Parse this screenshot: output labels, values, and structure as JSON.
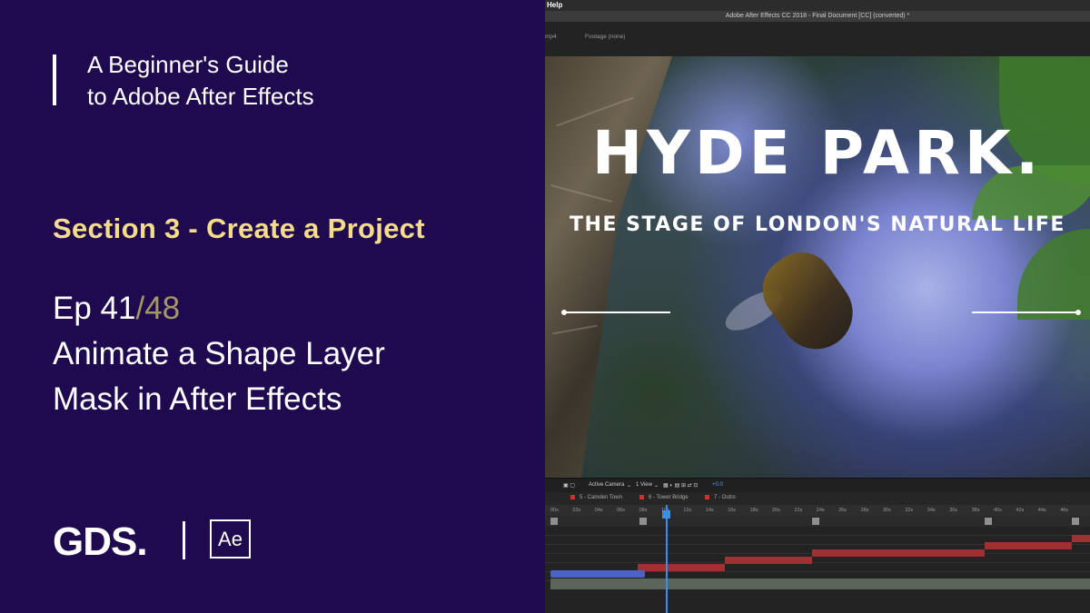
{
  "course": {
    "line1": "A Beginner's Guide",
    "line2": "to Adobe After Effects"
  },
  "section": {
    "label": "Section 3 - Create a Project"
  },
  "episode": {
    "number": "Ep 41",
    "total": "/48",
    "title_line1": "Animate a Shape Layer",
    "title_line2": "Mask in After Effects"
  },
  "logos": {
    "gds": "GDS.",
    "ae": "Ae"
  },
  "app": {
    "menu_help": "Help",
    "window_title": "Adobe After Effects CC 2018 - Final Document [CC] (converted) *",
    "panel_tab_1": "mp4",
    "panel_tab_2": "Footage (none)"
  },
  "composition": {
    "title": "HYDE PARK.",
    "subtitle": "THE STAGE OF LONDON'S NATURAL LIFE"
  },
  "viewer_controls": {
    "camera": "Active Camera",
    "view": "1 View",
    "offset": "+0.0"
  },
  "timeline": {
    "markers": [
      {
        "name": "marker-camden-town",
        "label": "5 - Camden Town"
      },
      {
        "name": "marker-tower-bridge",
        "label": "6 - Tower Bridge"
      },
      {
        "name": "marker-outro",
        "label": "7 - Outro"
      }
    ],
    "ruler_ticks": [
      "00s",
      "02s",
      "04s",
      "06s",
      "08s",
      "10s",
      "12s",
      "14s",
      "16s",
      "18s",
      "20s",
      "22s",
      "24s",
      "26s",
      "28s",
      "30s",
      "32s",
      "34s",
      "36s",
      "38s",
      "40s",
      "42s",
      "44s",
      "46s"
    ]
  },
  "colors": {
    "left_bg": "#1f0a4f",
    "section_text": "#f5dc8a",
    "episode_total": "#a49766",
    "playhead": "#3b8ef0",
    "layer_red": "#a03132",
    "layer_blue": "#4b63c8"
  }
}
